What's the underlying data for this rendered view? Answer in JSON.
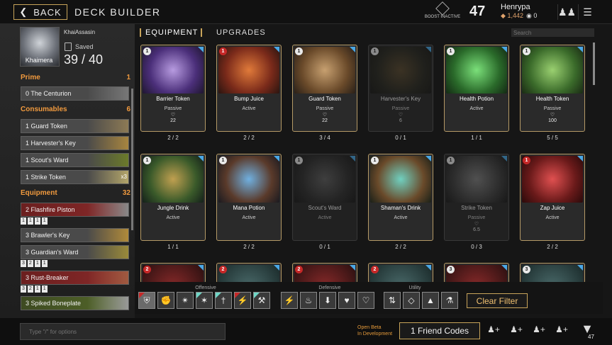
{
  "topbar": {
    "back_label": "BACK",
    "title": "DECK BUILDER",
    "boost_label": "BOOST INACTIVE",
    "level": "47",
    "username": "Henrypa",
    "coins": "1,442",
    "gems": "0"
  },
  "profile": {
    "name": "KhaiAssasin",
    "avatar_label": "Khaimera",
    "saved_label": "Saved",
    "card_count": "39 / 40"
  },
  "deck": {
    "prime": {
      "label": "Prime",
      "count": "1",
      "items": [
        {
          "label": "0  The Centurion"
        }
      ]
    },
    "consumables": {
      "label": "Consumables",
      "count": "6",
      "items": [
        {
          "label": "1  Guard Token"
        },
        {
          "label": "1  Harvester's Key"
        },
        {
          "label": "1  Scout's Ward"
        },
        {
          "label": "1  Strike Token",
          "badge": "x3"
        }
      ]
    },
    "equipment": {
      "label": "Equipment",
      "count": "32",
      "items": [
        {
          "label": "2  Flashfire Piston",
          "slots": [
            "1",
            "1",
            "1",
            "1"
          ]
        },
        {
          "label": "3  Brawler's Key"
        },
        {
          "label": "3  Guardian's Ward",
          "slots": [
            "3",
            "2",
            "1",
            "1"
          ]
        },
        {
          "label": "3  Rust-Breaker",
          "slots": [
            "3",
            "2",
            "1",
            "1"
          ]
        },
        {
          "label": "3  Spiked Boneplate"
        }
      ]
    }
  },
  "tabs": {
    "equipment": "EQUIPMENT",
    "upgrades": "UPGRADES"
  },
  "search": {
    "placeholder": "Search"
  },
  "cards": [
    {
      "cost": "1",
      "name": "Barrier Token",
      "type": "Passive",
      "stat": "22",
      "count": "2 / 2"
    },
    {
      "cost": "1",
      "name": "Bump Juice",
      "type": "Active",
      "stat": "",
      "count": "2 / 2"
    },
    {
      "cost": "1",
      "name": "Guard Token",
      "type": "Passive",
      "stat": "22",
      "count": "3 / 4"
    },
    {
      "cost": "1",
      "name": "Harvester's Key",
      "type": "Passive",
      "stat": "6",
      "count": "0 / 1"
    },
    {
      "cost": "1",
      "name": "Health Potion",
      "type": "Active",
      "stat": "",
      "count": "1 / 1"
    },
    {
      "cost": "1",
      "name": "Health Token",
      "type": "Passive",
      "stat": "100",
      "count": "5 / 5"
    },
    {
      "cost": "1",
      "name": "Jungle Drink",
      "type": "Active",
      "stat": "",
      "count": "1 / 1"
    },
    {
      "cost": "1",
      "name": "Mana Potion",
      "type": "Active",
      "stat": "",
      "count": "2 / 2"
    },
    {
      "cost": "1",
      "name": "Scout's Ward",
      "type": "Active",
      "stat": "",
      "count": "0 / 1"
    },
    {
      "cost": "1",
      "name": "Shaman's Drink",
      "type": "Active",
      "stat": "",
      "count": "2 / 2"
    },
    {
      "cost": "1",
      "name": "Strike Token",
      "type": "Passive",
      "stat": "6.5",
      "count": "0 / 3"
    },
    {
      "cost": "1",
      "name": "Zap Juice",
      "type": "Active",
      "stat": "",
      "count": "2 / 2"
    },
    {
      "cost": "2"
    },
    {
      "cost": "2"
    },
    {
      "cost": "2"
    },
    {
      "cost": "2"
    },
    {
      "cost": "3"
    },
    {
      "cost": "3"
    }
  ],
  "filters": {
    "offensive_label": "Offensive",
    "defensive_label": "Defensive",
    "utility_label": "Utility",
    "clear_label": "Clear Filter"
  },
  "bottombar": {
    "chat_placeholder": "Type \"/\" for options",
    "open_beta_line1": "Open Beta",
    "open_beta_line2": "In Development",
    "friend_codes_label": "1 Friend Codes",
    "notification_count": "47"
  },
  "colors": {
    "accent_gold": "#c8a45a",
    "section_orange": "#f19a3e",
    "corner_blue": "#4aa8e6"
  }
}
